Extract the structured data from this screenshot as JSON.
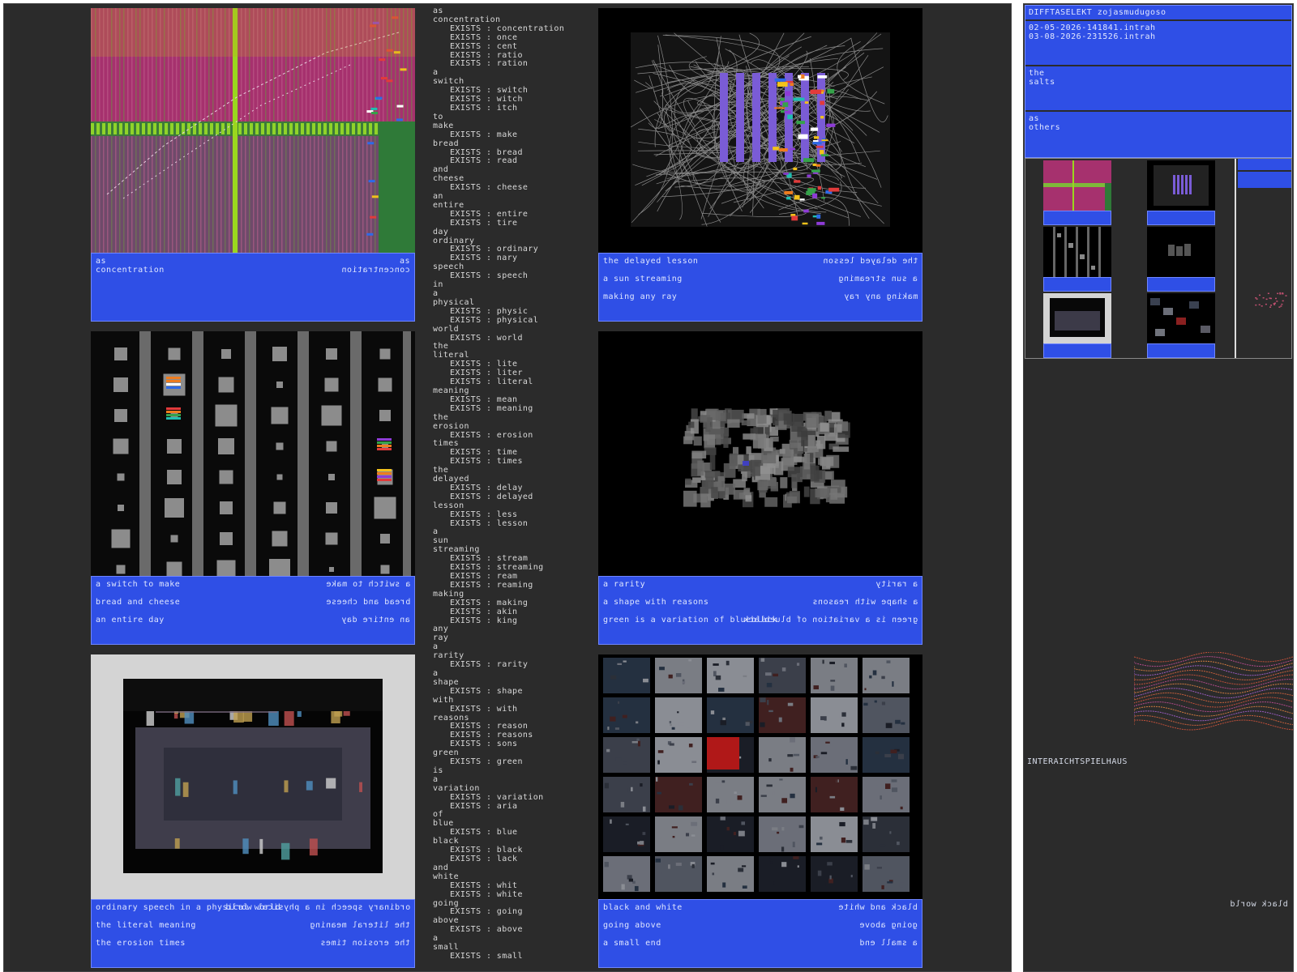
{
  "panels": [
    {
      "id": "p1",
      "caption": {
        "left1": "as",
        "left2": "concentration",
        "right1": "as",
        "right2": "concentration"
      }
    },
    {
      "id": "p2",
      "caption": {
        "rows": [
          "the delayed lesson",
          "a sun streaming",
          "making any ray"
        ]
      }
    },
    {
      "id": "p3",
      "caption": {
        "rows": [
          "a switch to make",
          "bread and cheese",
          "an entire day"
        ]
      }
    },
    {
      "id": "p4",
      "caption": {
        "rows": [
          "a rarity",
          "a shape with reasons",
          "green is a variation of blueblack"
        ]
      }
    },
    {
      "id": "p5",
      "caption": {
        "rows": [
          "ordinary speech in a physical world",
          "the literal meaning",
          "the erosion times"
        ]
      }
    },
    {
      "id": "p6",
      "caption": {
        "rows": [
          "black and white",
          "going above",
          "a small end"
        ]
      }
    }
  ],
  "wordlist": [
    [
      "as",
      []
    ],
    [
      "concentration",
      [
        "concentration",
        "once",
        "cent",
        "ratio",
        "ration"
      ]
    ],
    [
      "a",
      []
    ],
    [
      "switch",
      [
        "switch",
        "witch",
        "itch"
      ]
    ],
    [
      "to",
      []
    ],
    [
      "make",
      [
        "make"
      ]
    ],
    [
      "bread",
      [
        "bread",
        "read"
      ]
    ],
    [
      "and",
      []
    ],
    [
      "cheese",
      [
        "cheese"
      ]
    ],
    [
      "an",
      []
    ],
    [
      "entire",
      [
        "entire",
        "tire"
      ]
    ],
    [
      "day",
      []
    ],
    [
      "ordinary",
      [
        "ordinary",
        "nary"
      ]
    ],
    [
      "speech",
      [
        "speech"
      ]
    ],
    [
      "in",
      []
    ],
    [
      "a",
      []
    ],
    [
      "physical",
      [
        "physic",
        "physical"
      ]
    ],
    [
      "world",
      [
        "world"
      ]
    ],
    [
      "the",
      []
    ],
    [
      "literal",
      [
        "lite",
        "liter",
        "literal"
      ]
    ],
    [
      "meaning",
      [
        "mean",
        "meaning"
      ]
    ],
    [
      "the",
      []
    ],
    [
      "erosion",
      [
        "erosion"
      ]
    ],
    [
      "times",
      [
        "time",
        "times"
      ]
    ],
    [
      "the",
      []
    ],
    [
      "delayed",
      [
        "delay",
        "delayed"
      ]
    ],
    [
      "lesson",
      [
        "less",
        "lesson"
      ]
    ],
    [
      "a",
      []
    ],
    [
      "sun",
      []
    ],
    [
      "streaming",
      [
        "stream",
        "streaming",
        "ream",
        "reaming"
      ]
    ],
    [
      "making",
      [
        "making",
        "akin",
        "king"
      ]
    ],
    [
      "any",
      []
    ],
    [
      "ray",
      []
    ],
    [
      "a",
      []
    ],
    [
      "rarity",
      [
        "rarity"
      ]
    ],
    [
      "a",
      []
    ],
    [
      "shape",
      [
        "shape"
      ]
    ],
    [
      "with",
      [
        "with"
      ]
    ],
    [
      "reasons",
      [
        "reason",
        "reasons",
        "sons"
      ]
    ],
    [
      "green",
      [
        "green"
      ]
    ],
    [
      "is",
      []
    ],
    [
      "a",
      []
    ],
    [
      "variation",
      [
        "variation",
        "aria"
      ]
    ],
    [
      "of",
      []
    ],
    [
      "blue",
      [
        "blue"
      ]
    ],
    [
      "black",
      [
        "black",
        "lack"
      ]
    ],
    [
      "and",
      []
    ],
    [
      "white",
      [
        "whit",
        "white"
      ]
    ],
    [
      "going",
      [
        "going"
      ]
    ],
    [
      "above",
      [
        "above"
      ]
    ],
    [
      "a",
      []
    ],
    [
      "small",
      [
        "small"
      ]
    ]
  ],
  "exists_label": "EXISTS :",
  "side": {
    "header": "DIFFTASELEKT zojasmudugoso",
    "file1": "02-05-2026-141841.intrah",
    "file2": "03-08-2026-231526.intrah",
    "the_line1": "the",
    "the_line2": "salts",
    "as_line1": "as",
    "as_line2": "others",
    "intera_label": "INTERAICHTSPIELHAUS",
    "mirror_label": "black world"
  },
  "colors": {
    "caption_blue": "#2f4fe6",
    "bg_dark": "#2b2b2b",
    "text": "#d6dbe8"
  }
}
